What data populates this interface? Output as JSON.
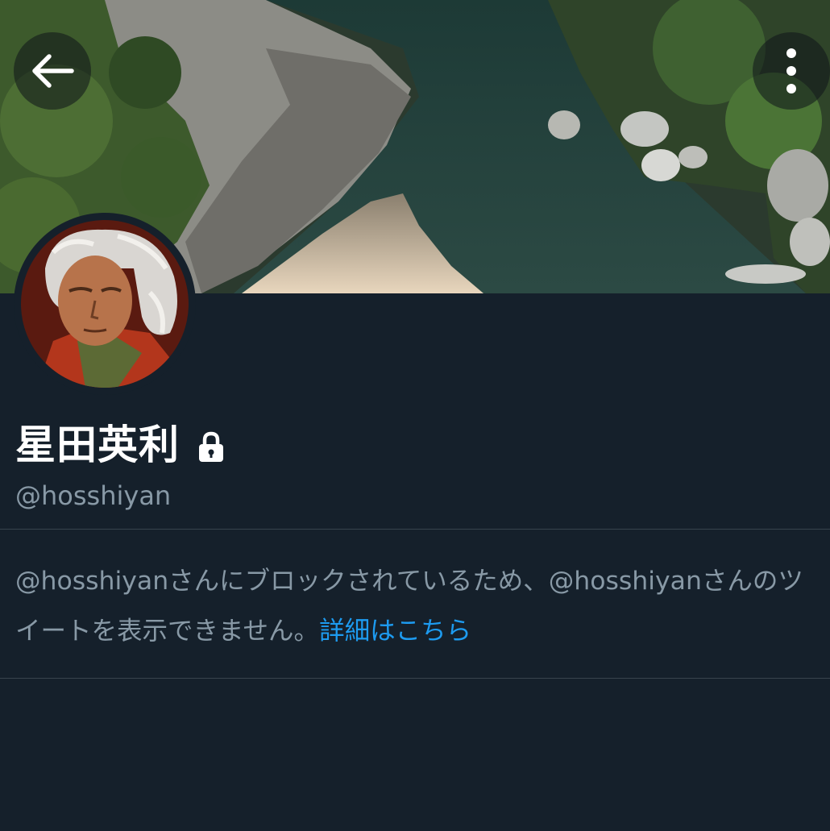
{
  "header": {
    "back_icon": "arrow-left-icon",
    "more_icon": "more-vertical-icon"
  },
  "profile": {
    "display_name": "星田英利",
    "protected_icon": "lock-icon",
    "handle": "@hosshiyan"
  },
  "blocked_notice": {
    "message": "@hosshiyanさんにブロックされているため、@hosshiyanさんのツイートを表示できません。",
    "link_label": "詳細はこちら"
  },
  "colors": {
    "background": "#15202b",
    "secondary_text": "#8899a6",
    "link": "#1d9bf0",
    "divider": "#38444d"
  }
}
